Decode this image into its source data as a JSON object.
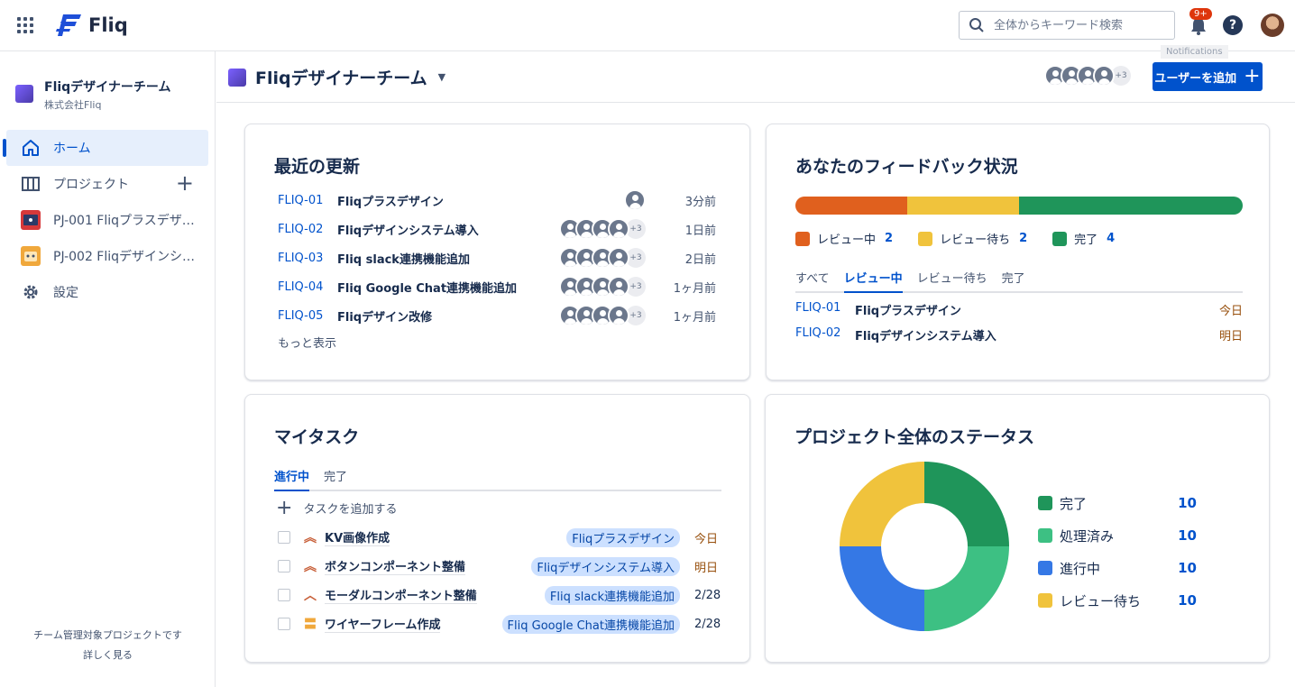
{
  "app": {
    "name": "Fliq"
  },
  "search": {
    "placeholder": "全体からキーワード検索"
  },
  "notifications": {
    "badge": "9+",
    "tooltip": "Notifications"
  },
  "help": {
    "label": "?"
  },
  "sidebar": {
    "team_name": "Fliqデザイナーチーム",
    "company": "株式会社Fliq",
    "items": [
      {
        "label": "ホーム",
        "icon": "home-icon"
      },
      {
        "label": "プロジェクト",
        "icon": "board-icon"
      },
      {
        "label": "PJ-001 Fliqプラスデザ…",
        "icon": "project-icon"
      },
      {
        "label": "PJ-002 Fliqデザインシ…",
        "icon": "project-icon"
      },
      {
        "label": "設定",
        "icon": "gear-icon"
      }
    ],
    "footer_text": "チーム管理対象プロジェクトです",
    "footer_link": "詳しく見る"
  },
  "header": {
    "title": "Fliqデザイナーチーム",
    "member_more": "+3",
    "add_user_label": "ユーザーを追加"
  },
  "recent": {
    "title": "最近の更新",
    "rows": [
      {
        "key": "FLIQ-01",
        "title": "Fliqプラスデザイン",
        "time": "3分前",
        "more": ""
      },
      {
        "key": "FLIQ-02",
        "title": "Fliqデザインシステム導入",
        "time": "1日前",
        "more": "+3"
      },
      {
        "key": "FLIQ-03",
        "title": "Fliq slack連携機能追加",
        "time": "2日前",
        "more": "+3"
      },
      {
        "key": "FLIQ-04",
        "title": "Fliq Google Chat連携機能追加",
        "time": "1ヶ月前",
        "more": "+3"
      },
      {
        "key": "FLIQ-05",
        "title": "Fliqデザイン改修",
        "time": "1ヶ月前",
        "more": "+3"
      }
    ],
    "more_label": "もっと表示"
  },
  "feedback": {
    "title": "あなたのフィードバック状況",
    "segments": [
      {
        "label": "レビュー中",
        "count": "2",
        "color": "#e0601e"
      },
      {
        "label": "レビュー待ち",
        "count": "2",
        "color": "#f0c33c"
      },
      {
        "label": "完了",
        "count": "4",
        "color": "#1f955a"
      }
    ],
    "tabs": [
      "すべて",
      "レビュー中",
      "レビュー待ち",
      "完了"
    ],
    "active_tab": "レビュー中",
    "rows": [
      {
        "key": "FLIQ-01",
        "title": "Fliqプラスデザイン",
        "due": "今日"
      },
      {
        "key": "FLIQ-02",
        "title": "Fliqデザインシステム導入",
        "due": "明日"
      }
    ]
  },
  "tasks": {
    "title": "マイタスク",
    "tabs": [
      "進行中",
      "完了"
    ],
    "active_tab": "進行中",
    "add_label": "タスクを追加する",
    "rows": [
      {
        "title": "KV画像作成",
        "project": "Fliqプラスデザイン",
        "due": "今日",
        "priority": "highest-priority-icon",
        "priority_color": "#c8603a",
        "due_color": "#974f0c"
      },
      {
        "title": "ボタンコンポーネント整備",
        "project": "Fliqデザインシステム導入",
        "due": "明日",
        "priority": "highest-priority-icon",
        "priority_color": "#c8603a",
        "due_color": "#974f0c"
      },
      {
        "title": "モーダルコンポーネント整備",
        "project": "Fliq slack連携機能追加",
        "due": "2/28",
        "priority": "high-priority-icon",
        "priority_color": "#c8603a",
        "due_color": "#172b4d"
      },
      {
        "title": "ワイヤーフレーム作成",
        "project": "Fliq Google Chat連携機能追加",
        "due": "2/28",
        "priority": "medium-priority-icon",
        "priority_color": "#f0a83c",
        "due_color": "#172b4d"
      }
    ]
  },
  "status": {
    "title": "プロジェクト全体のステータス",
    "items": [
      {
        "label": "完了",
        "value": "10",
        "color": "#1f955a"
      },
      {
        "label": "処理済み",
        "value": "10",
        "color": "#3dc083"
      },
      {
        "label": "進行中",
        "value": "10",
        "color": "#3578e5"
      },
      {
        "label": "レビュー待ち",
        "value": "10",
        "color": "#f0c33c"
      }
    ]
  }
}
